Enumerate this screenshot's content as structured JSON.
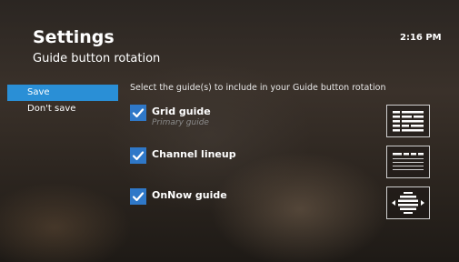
{
  "header": {
    "title": "Settings",
    "subtitle": "Guide button rotation",
    "clock": "2:16 PM"
  },
  "menu": {
    "items": [
      {
        "label": "Save",
        "active": true
      },
      {
        "label": "Don't save",
        "active": false
      }
    ]
  },
  "instructions": "Select the guide(s) to include in your Guide button rotation",
  "options": [
    {
      "label": "Grid guide",
      "sublabel": "Primary guide",
      "checked": true,
      "icon": "grid-guide-icon"
    },
    {
      "label": "Channel lineup",
      "checked": true,
      "icon": "channel-lineup-icon"
    },
    {
      "label": "OnNow guide",
      "checked": true,
      "icon": "onnow-guide-icon"
    }
  ],
  "colors": {
    "accent": "#2a8fd6",
    "checkbox": "#2f78c8",
    "text": "#ffffff",
    "subtext": "#8a8a8a"
  }
}
